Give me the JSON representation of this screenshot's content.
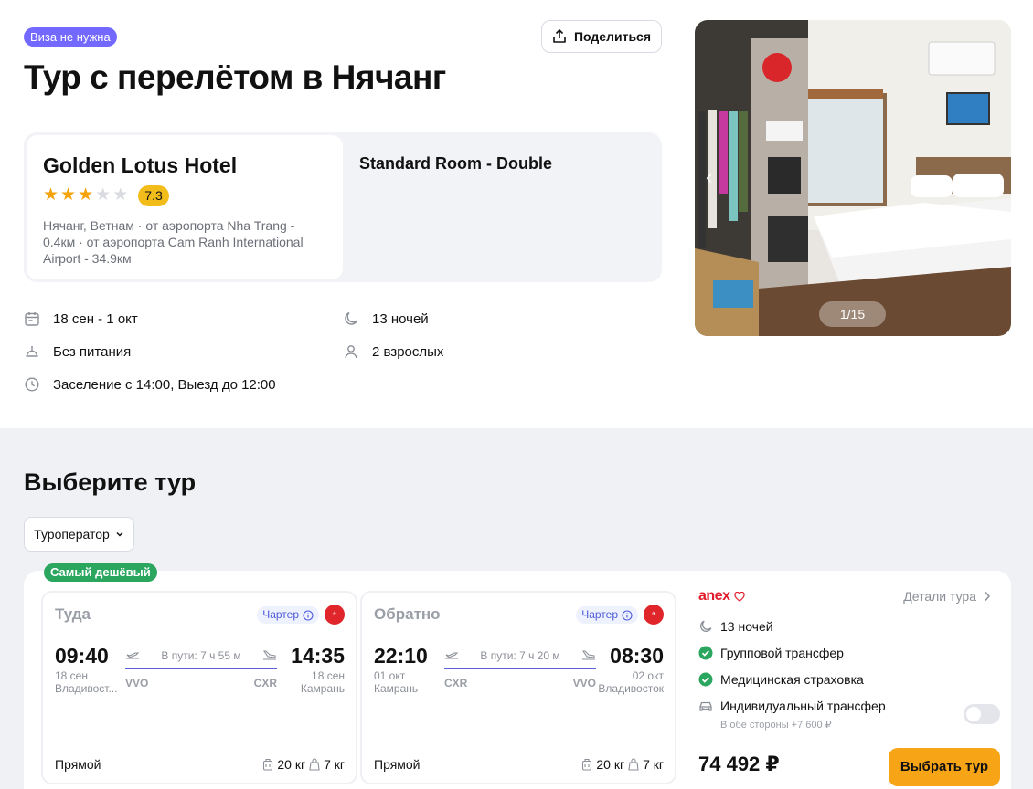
{
  "header": {
    "visa_badge": "Виза не нужна",
    "share_label": "Поделиться",
    "title": "Тур с перелётом в Нячанг"
  },
  "hotel": {
    "name": "Golden Lotus Hotel",
    "stars": 3,
    "rating": "7.3",
    "location": "Нячанг, Ветнам · от аэропорта Nha Trang - 0.4км · от аэропорта Cam Ranh International Airport - 34.9км",
    "room": "Standard Room - Double"
  },
  "info": {
    "dates": "18 сен - 1 окт",
    "nights": "13 ночей",
    "meal": "Без питания",
    "guests": "2 взрослых",
    "checkin": "Заселение с 14:00, Выезд до 12:00"
  },
  "photo": {
    "counter": "1/15",
    "prev_icon": "chevron-left-icon",
    "next_icon": "chevron-right-icon"
  },
  "choose": {
    "title": "Выберите тур",
    "operator_filter": "Туроператор"
  },
  "tour": {
    "cheapest_badge": "Самый дешёвый",
    "outbound": {
      "direction": "Туда",
      "charter": "Чартер",
      "dep_time": "09:40",
      "dep_date": "18 сен",
      "dep_city": "Владивост...",
      "arr_time": "14:35",
      "arr_date": "18 сен",
      "arr_city": "Камрань",
      "travel": "В пути: 7 ч 55 м",
      "dep_iata": "VVO",
      "arr_iata": "CXR",
      "type": "Прямой",
      "baggage": "20 кг",
      "hand": "7 кг"
    },
    "return": {
      "direction": "Обратно",
      "charter": "Чартер",
      "dep_time": "22:10",
      "dep_date": "01 окт",
      "dep_city": "Камрань",
      "arr_time": "08:30",
      "arr_date": "02 окт",
      "arr_city": "Владивосток",
      "travel": "В пути: 7 ч 20 м",
      "dep_iata": "CXR",
      "arr_iata": "VVO",
      "type": "Прямой",
      "baggage": "20 кг",
      "hand": "7 кг"
    },
    "operator": "anex",
    "details_link": "Детали тура",
    "features": {
      "nights": "13 ночей",
      "transfer": "Групповой трансфер",
      "insurance": "Медицинская страховка",
      "individual": "Индивидуальный трансфер",
      "individual_sub": "В обе стороны +7 600 ₽"
    },
    "individual_transfer_enabled": false,
    "price": "74 492 ₽",
    "select_label": "Выбрать тур"
  },
  "colors": {
    "accent": "#7368ff",
    "primary_button": "#f7a417",
    "success": "#2aa65f",
    "rating": "#f2bd1b",
    "star": "#f5a30b",
    "anex_red": "#e21b2b"
  }
}
